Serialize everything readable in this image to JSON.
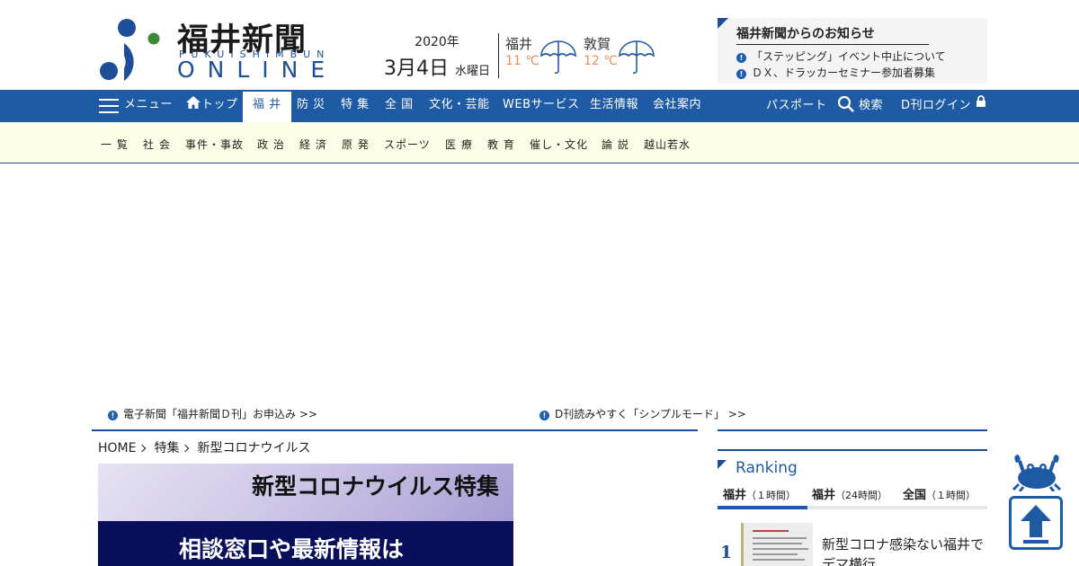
{
  "header": {
    "logo_title": "福井新聞",
    "logo_sub": "FUKUISHIMBUN",
    "logo_online": "ONLINE",
    "date_year": "2020年",
    "date_day": "3月4日",
    "date_weekday": "水曜日",
    "weather": [
      {
        "city": "福井",
        "temp": "11 ℃",
        "icon": "umbrella-icon"
      },
      {
        "city": "敦賀",
        "temp": "12 ℃",
        "icon": "umbrella-icon"
      }
    ],
    "notice": {
      "title": "福井新聞からのお知らせ",
      "items": [
        "「ステッピング」イベント中止について",
        "ＤＸ、ドラッカーセミナー参加者募集"
      ]
    }
  },
  "nav": {
    "menu_label": "メニュー",
    "items": [
      "トップ",
      "福 井",
      "防 災",
      "特 集",
      "全 国",
      "文化・芸能",
      "WEBサービス",
      "生活情報",
      "会社案内"
    ],
    "active": "福 井",
    "right": {
      "passport": "パスポート",
      "search": "検索",
      "login": "D刊ログイン"
    }
  },
  "subnav": {
    "items": [
      "一 覧",
      "社 会",
      "事件・事故",
      "政 治",
      "経 済",
      "原 発",
      "スポーツ",
      "医 療",
      "教 育",
      "催し・文化",
      "論 説",
      "越山若水"
    ]
  },
  "promos": [
    "電子新聞「福井新聞Ｄ刊」お申込み >>",
    "D刊読みやすく「シンプルモード」 >>"
  ],
  "breadcrumb": [
    "HOME",
    "特集",
    "新型コロナウイルス"
  ],
  "banner": {
    "title": "新型コロナウイルス特集",
    "sub": "相談窓口や最新情報は"
  },
  "ranking": {
    "title": "Ranking",
    "tabs": [
      {
        "name": "福井",
        "period": "（１時間）"
      },
      {
        "name": "福井",
        "period": "（24時間）"
      },
      {
        "name": "全国",
        "period": "（１時間）"
      }
    ],
    "items": [
      {
        "rank": "1",
        "text": "新型コロナ感染ない福井でデマ横行"
      }
    ]
  },
  "colors": {
    "brand_blue": "#1f5ba5",
    "subnav_bg": "#fdfce6",
    "temp_orange": "#f08c5a"
  }
}
